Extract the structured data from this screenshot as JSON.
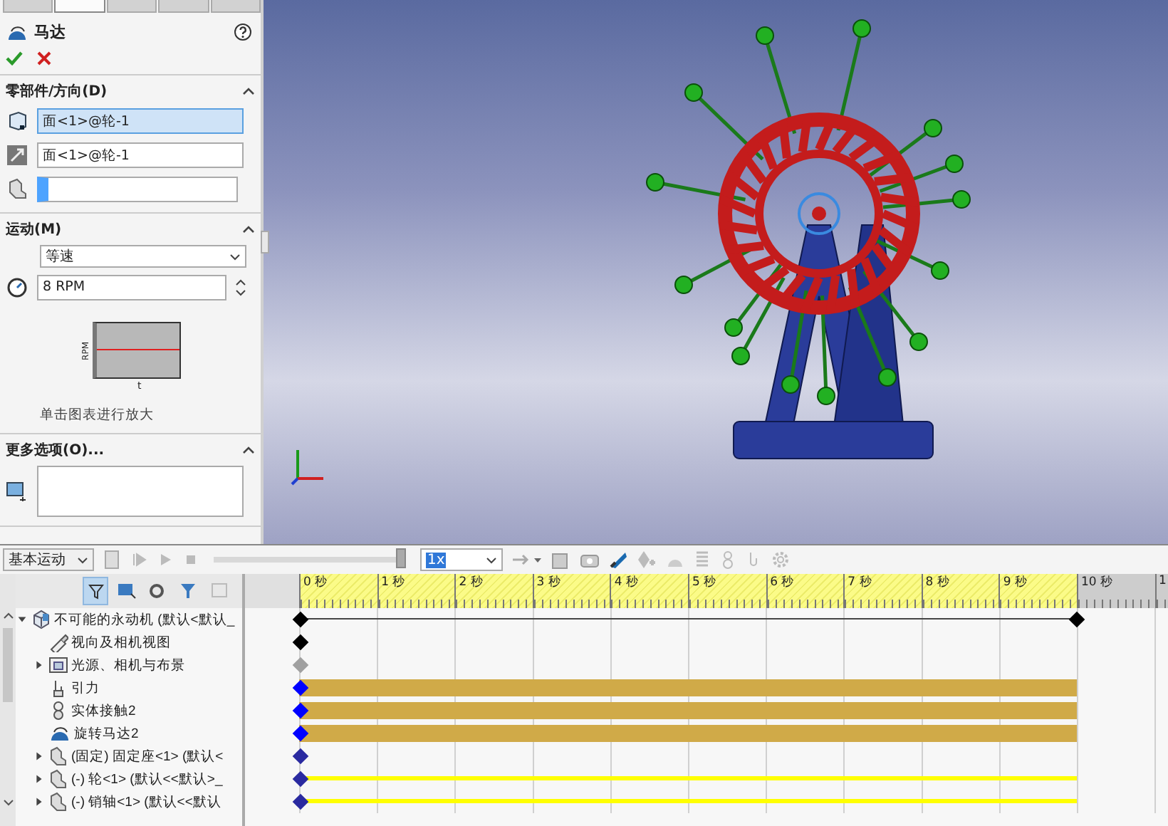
{
  "property_manager": {
    "tabs": [
      {
        "selected": false
      },
      {
        "selected": true
      },
      {
        "selected": false
      },
      {
        "selected": false
      },
      {
        "selected": false
      }
    ],
    "title": "马达",
    "sections": [
      {
        "title": "零部件/方向(D)",
        "expanded": true,
        "kind": "direction",
        "fields": [
          {
            "value": "面<1>@轮-1",
            "selected": true
          },
          {
            "value": "面<1>@轮-1",
            "selected": false
          },
          {
            "selected": false
          }
        ]
      },
      {
        "title": "运动(M)",
        "expanded": true,
        "kind": "motion",
        "type_value": "等速",
        "speed_value": "8 RPM",
        "graph": {
          "ylabel": "RPM",
          "xlabel": "t"
        },
        "caption": "单击图表进行放大"
      },
      {
        "title": "更多选项(O)...",
        "expanded": true,
        "kind": "more"
      }
    ]
  },
  "toolbar": {
    "study_type": "基本运动",
    "slider": {
      "level": 0.98
    },
    "playback_speed": "1x"
  },
  "timeline": {
    "ticks": [
      "0 秒",
      "1 秒",
      "2 秒",
      "3 秒",
      "4 秒",
      "5 秒",
      "6 秒",
      "7 秒",
      "8 秒",
      "9 秒",
      "10 秒",
      "1"
    ],
    "rows": [
      {
        "kind": "span"
      },
      {
        "kind": "view"
      },
      {
        "kind": "inactive"
      },
      {
        "kind": "simulation"
      },
      {
        "kind": "simulation"
      },
      {
        "kind": "simulation"
      },
      {
        "kind": "fixed"
      },
      {
        "kind": "moving"
      },
      {
        "kind": "moving"
      }
    ]
  },
  "tree": [
    {
      "label": "不可能的永动机 (默认<默认_",
      "expanded": true,
      "kind": "assembly",
      "children": [
        {
          "label": "视向及相机视图",
          "kind": "camera"
        },
        {
          "label": "光源、相机与布景",
          "expanded": false,
          "kind": "scene"
        },
        {
          "label": "引力",
          "kind": "gravity"
        },
        {
          "label": "实体接触2",
          "kind": "contact"
        },
        {
          "label": "旋转马达2",
          "kind": "motor"
        },
        {
          "label": "(固定) 固定座<1> (默认<",
          "expanded": false,
          "kind": "part"
        },
        {
          "label": "(-) 轮<1> (默认<<默认>_",
          "expanded": false,
          "kind": "part"
        },
        {
          "label": "(-) 销轴<1> (默认<<默认",
          "expanded": false,
          "kind": "part"
        }
      ]
    }
  ]
}
